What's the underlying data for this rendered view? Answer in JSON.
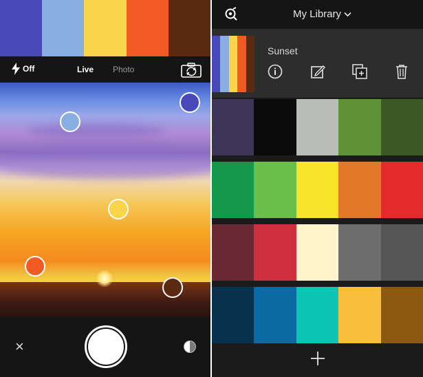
{
  "capture": {
    "captured_palette": [
      "#4848b8",
      "#8aaee2",
      "#f8d54a",
      "#f15a22",
      "#5c2a10"
    ],
    "toolbar": {
      "flash_label": "Off",
      "mode_live": "Live",
      "mode_photo": "Photo"
    },
    "samples": [
      {
        "color": "#8aaee2"
      },
      {
        "color": "#4848b8"
      },
      {
        "color": "#f8d54a"
      },
      {
        "color": "#f15a22"
      },
      {
        "color": "#5c2a10"
      }
    ],
    "icons": {
      "flash": "flash-icon",
      "switch_camera": "switch-camera-icon",
      "close": "close-icon",
      "shutter": "shutter-button",
      "filter": "filter-icon"
    },
    "close_glyph": "×"
  },
  "library": {
    "title": "My Library",
    "selected": {
      "name": "Sunset",
      "colors": [
        "#4848b8",
        "#8aaee2",
        "#f8d54a",
        "#f15a22",
        "#5c2a10"
      ],
      "actions": [
        "info-icon",
        "edit-icon",
        "copy-icon",
        "delete-icon"
      ]
    },
    "palettes": [
      {
        "colors": [
          "#3d3558",
          "#0b0b0b",
          "#b9bdb9",
          "#5f9138",
          "#3b5a26"
        ]
      },
      {
        "colors": [
          "#14994c",
          "#6abf4b",
          "#f7e32a",
          "#e27928",
          "#e32b2b"
        ]
      },
      {
        "colors": [
          "#6b2934",
          "#cf3040",
          "#fff4cc",
          "#6d6d6d",
          "#555555"
        ]
      },
      {
        "colors": [
          "#07314d",
          "#0b6aa2",
          "#0cc5b2",
          "#f9bf3c",
          "#8b5a10"
        ]
      }
    ],
    "add_glyph": "+"
  }
}
